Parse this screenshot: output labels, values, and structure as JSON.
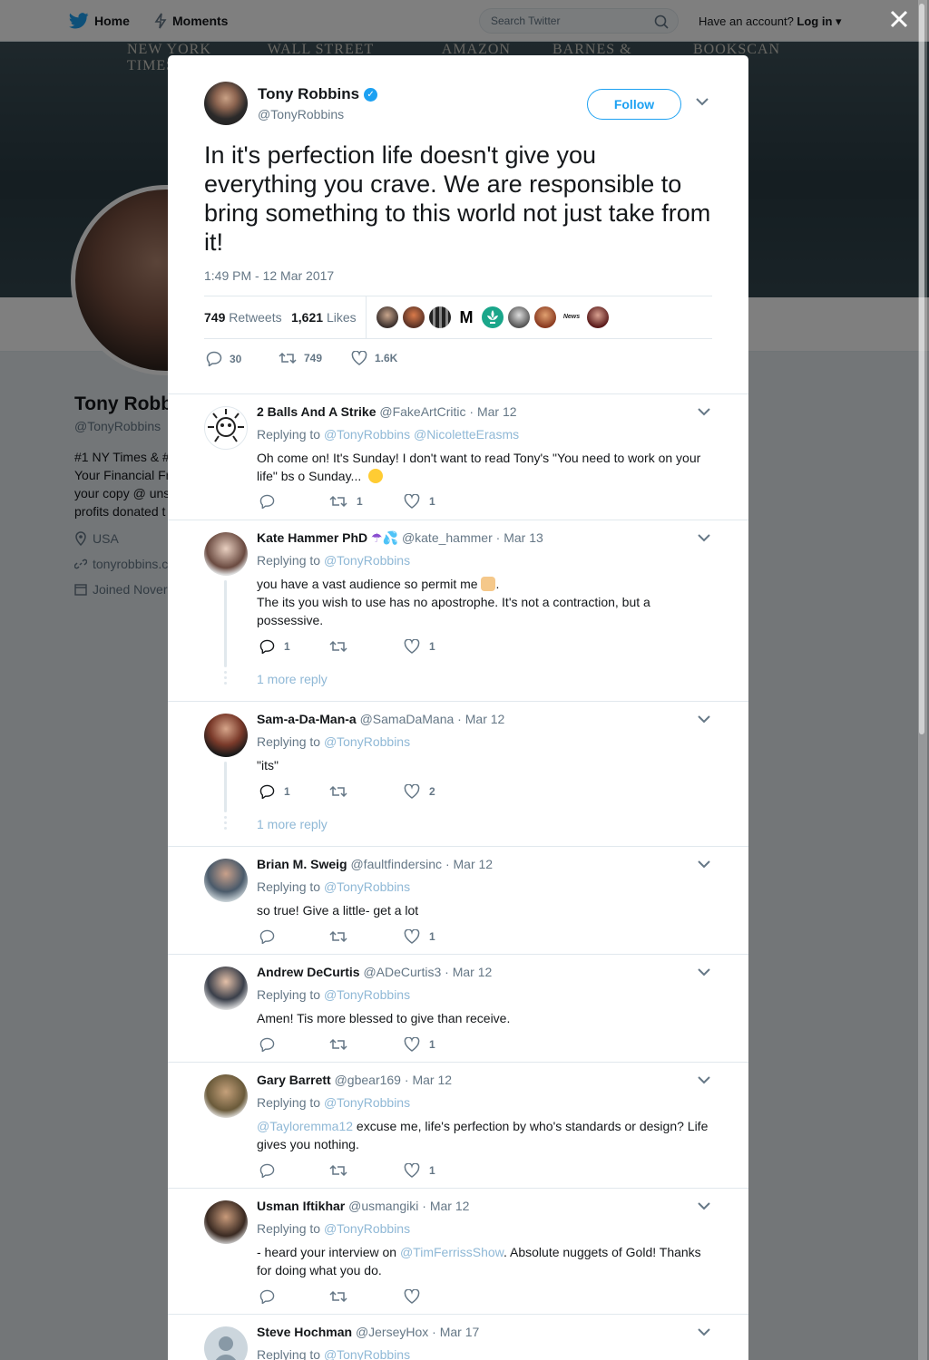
{
  "nav": {
    "home": "Home",
    "moments": "Moments",
    "search_placeholder": "Search Twitter",
    "have_account": "Have an account?",
    "login": "Log in"
  },
  "banner": {
    "items": [
      "NEW YORK TIMES",
      "WALL STREET JOURNAL",
      "AMAZON",
      "BARNES & NOBLE",
      "BOOKSCAN"
    ]
  },
  "profile": {
    "name": "Tony Robb",
    "handle": "@TonyRobbins",
    "bio_lines": [
      "#1 NY Times & #",
      "Your Financial Fr",
      "your copy @ uns",
      "profits donated t"
    ],
    "location": "USA",
    "website": "tonyrobbins.c",
    "joined": "Joined Nover"
  },
  "tweet": {
    "name": "Tony Robbins",
    "handle": "@TonyRobbins",
    "follow_label": "Follow",
    "text": "In it's perfection life doesn't give you everything you crave. We are responsible to bring something to this world not just take from it!",
    "timestamp": "1:49 PM - 12 Mar 2017",
    "retweets_count": "749",
    "retweets_label": "Retweets",
    "likes_count": "1,621",
    "likes_label": "Likes",
    "liker_m": "M",
    "liker_news": "News",
    "action_reply": "30",
    "action_retweet": "749",
    "action_like": "1.6K"
  },
  "replies": [
    {
      "name": "2 Balls And A Strike",
      "handle": "@FakeArtCritic",
      "date": "Mar 12",
      "replying_prefix": "Replying to",
      "replying_to": "@TonyRobbins @NicoletteErasms",
      "text": "Oh come on! It's Sunday! I don't want to read Tony's \"You need to work on your life\" bs o Sunday...",
      "reply_count": "",
      "retweet_count": "1",
      "like_count": "1"
    },
    {
      "name": "Kate Hammer PhD",
      "handle": "@kate_hammer",
      "date": "Mar 13",
      "replying_prefix": "Replying to",
      "replying_to": "@TonyRobbins",
      "text_line1": "you have a vast audience so permit me",
      "text_line2": "The its you wish to use has no apostrophe. It's not a contraction, but a possessive.",
      "reply_count": "1",
      "retweet_count": "",
      "like_count": "1",
      "more": "1 more reply"
    },
    {
      "name": "Sam-a-Da-Man-a",
      "handle": "@SamaDaMana",
      "date": "Mar 12",
      "replying_prefix": "Replying to",
      "replying_to": "@TonyRobbins",
      "text": "\"its\"",
      "reply_count": "1",
      "retweet_count": "",
      "like_count": "2",
      "more": "1 more reply"
    },
    {
      "name": "Brian M. Sweig",
      "handle": "@faultfindersinc",
      "date": "Mar 12",
      "replying_prefix": "Replying to",
      "replying_to": "@TonyRobbins",
      "text": "so true! Give a little- get a lot",
      "reply_count": "",
      "retweet_count": "",
      "like_count": "1"
    },
    {
      "name": "Andrew DeCurtis",
      "handle": "@ADeCurtis3",
      "date": "Mar 12",
      "replying_prefix": "Replying to",
      "replying_to": "@TonyRobbins",
      "text": "Amen! Tis more blessed to give than receive.",
      "reply_count": "",
      "retweet_count": "",
      "like_count": "1"
    },
    {
      "name": "Gary Barrett",
      "handle": "@gbear169",
      "date": "Mar 12",
      "replying_prefix": "Replying to",
      "replying_to": "@TonyRobbins",
      "mention": "@Tayloremma12",
      "text": "excuse me, life's perfection by who's standards or design? Life gives you nothing.",
      "reply_count": "",
      "retweet_count": "",
      "like_count": "1"
    },
    {
      "name": "Usman Iftikhar",
      "handle": "@usmangiki",
      "date": "Mar 12",
      "replying_prefix": "Replying to",
      "replying_to": "@TonyRobbins",
      "text_before": "- heard your interview on",
      "mention": "@TimFerrissShow",
      "text_after": ". Absolute nuggets of Gold! Thanks for doing what you do.",
      "reply_count": "",
      "retweet_count": "",
      "like_count": ""
    },
    {
      "name": "Steve Hochman",
      "handle": "@JerseyHox",
      "date": "Mar 17",
      "replying_prefix": "Replying to",
      "replying_to": "@TonyRobbins"
    }
  ],
  "colors": {
    "twitter_blue": "#1da1f2",
    "text_primary": "#14171a",
    "text_secondary": "#657786",
    "link_muted": "#8fb8d6",
    "border": "#e1e8ed"
  }
}
